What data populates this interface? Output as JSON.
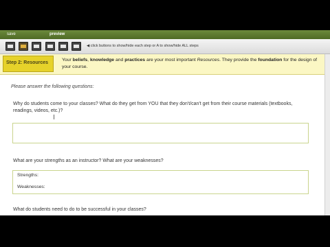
{
  "topbar": {
    "save_label": "save",
    "preview_label": "preview"
  },
  "toolbar": {
    "step_buttons": [
      "step-1",
      "step-2",
      "step-3",
      "step-4",
      "step-5",
      "step-6"
    ],
    "hint": "◀ click buttons to show/hide each step or A to show/hide ALL steps"
  },
  "step": {
    "label": "Step 2: Resources",
    "desc_pre": "Your ",
    "desc_b1": "beliefs",
    "desc_mid1": ", ",
    "desc_b2": "knowledge",
    "desc_mid2": " and ",
    "desc_b3": "practices",
    "desc_mid3": " are your most important ",
    "desc_i1": "Resources",
    "desc_mid4": ". They provide the ",
    "desc_b4": "foundation",
    "desc_post": " for the design of your course."
  },
  "form": {
    "instruction": "Please answer the following questions:",
    "q1": "Why do students come to your classes? What do they get from YOU that they don't/can't get from their course materials (textbooks, readings, videos, etc.)?",
    "q2": "What are your strengths as an instructor? What are your weaknesses?",
    "q2_strengths": "Strengths:",
    "q2_weaknesses": "Weaknesses:",
    "q3": "What do students need to do to be successful in your classes?"
  },
  "colors": {
    "topbar": "#5a7a2e",
    "step_label_bg": "#e6d22a",
    "step_bar_bg": "#fbf7c4",
    "answer_border": "#c9d48c"
  }
}
